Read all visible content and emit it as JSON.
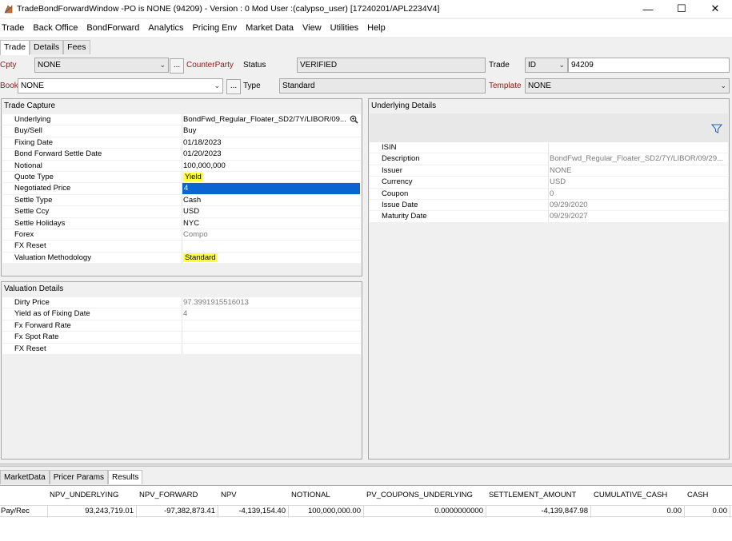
{
  "window": {
    "title": "TradeBondForwardWindow  -PO is NONE  (94209) - Version : 0 Mod User :(calypso_user)  [17240201/APL2234V4]",
    "minimize": "—",
    "maximize": "☐",
    "close": "✕"
  },
  "menu": [
    "Trade",
    "Back Office",
    "BondForward",
    "Analytics",
    "Pricing Env",
    "Market Data",
    "View",
    "Utilities",
    "Help"
  ],
  "tabs": [
    "Trade",
    "Details",
    "Fees"
  ],
  "header": {
    "cpty_label": "Cpty",
    "cpty_value": "NONE",
    "dots": "...",
    "counterparty_label": "CounterParty",
    "status_label": "Status",
    "status_value": "VERIFIED",
    "trade_label": "Trade",
    "id_type": "ID",
    "id_value": "94209",
    "book_label": "Book",
    "book_value": "NONE",
    "type_label": "Type",
    "type_value": "Standard",
    "template_label": "Template",
    "template_value": "NONE"
  },
  "trade_capture": {
    "title": "Trade Capture",
    "rows": [
      {
        "label": "Underlying",
        "value": "BondFwd_Regular_Floater_SD2/7Y/LIBOR/09..."
      },
      {
        "label": "Buy/Sell",
        "value": "Buy"
      },
      {
        "label": "Fixing Date",
        "value": "01/18/2023"
      },
      {
        "label": "Bond Forward Settle Date",
        "value": "01/20/2023"
      },
      {
        "label": "Notional",
        "value": "100,000,000"
      },
      {
        "label": "Quote Type",
        "value": "Yield"
      },
      {
        "label": "Negotiated Price",
        "value": "4"
      },
      {
        "label": "Settle Type",
        "value": "Cash"
      },
      {
        "label": "Settle Ccy",
        "value": "USD"
      },
      {
        "label": "Settle Holidays",
        "value": "NYC"
      },
      {
        "label": "Forex",
        "value": "Compo"
      },
      {
        "label": "FX Reset",
        "value": ""
      },
      {
        "label": "Valuation Methodology",
        "value": "Standard"
      }
    ]
  },
  "valuation_details": {
    "title": "Valuation Details",
    "rows": [
      {
        "label": "Dirty Price",
        "value": "97.3991915516013"
      },
      {
        "label": "Yield as of Fixing Date",
        "value": "4"
      },
      {
        "label": "Fx Forward Rate",
        "value": ""
      },
      {
        "label": "Fx Spot Rate",
        "value": ""
      },
      {
        "label": "FX Reset",
        "value": ""
      }
    ]
  },
  "underlying_details": {
    "title": "Underlying Details",
    "rows": [
      {
        "label": "ISIN",
        "value": ""
      },
      {
        "label": "Description",
        "value": "BondFwd_Regular_Floater_SD2/7Y/LIBOR/09/29..."
      },
      {
        "label": "Issuer",
        "value": "NONE"
      },
      {
        "label": "Currency",
        "value": "USD"
      },
      {
        "label": "Coupon",
        "value": "0"
      },
      {
        "label": "Issue Date",
        "value": "09/29/2020"
      },
      {
        "label": "Maturity Date",
        "value": "09/29/2027"
      }
    ]
  },
  "bottom_tabs": [
    "MarketData",
    "Pricer Params",
    "Results"
  ],
  "results": {
    "headers": [
      "NPV_UNDERLYING",
      "NPV_FORWARD",
      "NPV",
      "NOTIONAL",
      "PV_COUPONS_UNDERLYING",
      "SETTLEMENT_AMOUNT",
      "CUMULATIVE_CASH",
      "CASH"
    ],
    "row_label": "Pay/Rec",
    "values": [
      "93,243,719.01",
      "-97,382,873.41",
      "-4,139,154.40",
      "100,000,000.00",
      "0.0000000000",
      "-4,139,847.98",
      "0.00",
      "0.00"
    ]
  },
  "colors": {
    "highlight": "#ffff33",
    "selection": "#0a64d2",
    "red_label": "#8b1a1a"
  },
  "icons": {
    "app": "app-icon",
    "magnifier": "zoom-icon",
    "filter": "filter-icon"
  }
}
